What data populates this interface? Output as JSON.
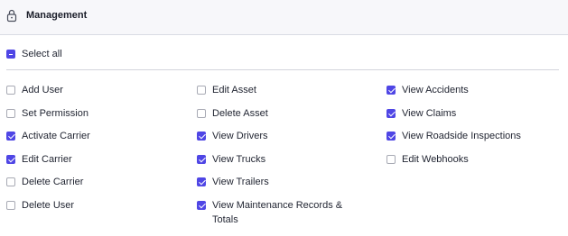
{
  "section": {
    "title": "Management",
    "icon": "lock-icon"
  },
  "select_all": {
    "label": "Select all",
    "state": "indeterminate"
  },
  "columns": [
    [
      {
        "label": "Add User",
        "checked": false
      },
      {
        "label": "Set Permission",
        "checked": false
      },
      {
        "label": "Activate Carrier",
        "checked": true
      },
      {
        "label": "Edit Carrier",
        "checked": true
      },
      {
        "label": "Delete Carrier",
        "checked": false
      },
      {
        "label": "Delete User",
        "checked": false
      }
    ],
    [
      {
        "label": "Edit Asset",
        "checked": false
      },
      {
        "label": "Delete Asset",
        "checked": false
      },
      {
        "label": "View Drivers",
        "checked": true
      },
      {
        "label": "View Trucks",
        "checked": true
      },
      {
        "label": "View Trailers",
        "checked": true
      },
      {
        "label": "View Maintenance Records & Totals",
        "checked": true
      }
    ],
    [
      {
        "label": "View Accidents",
        "checked": true
      },
      {
        "label": "View Claims",
        "checked": true
      },
      {
        "label": "View Roadside Inspections",
        "checked": true
      },
      {
        "label": "Edit Webhooks",
        "checked": false
      }
    ]
  ],
  "colors": {
    "accent": "#4f46e5",
    "header_bg": "#f7f7fa",
    "divider": "#d3d5dc"
  }
}
